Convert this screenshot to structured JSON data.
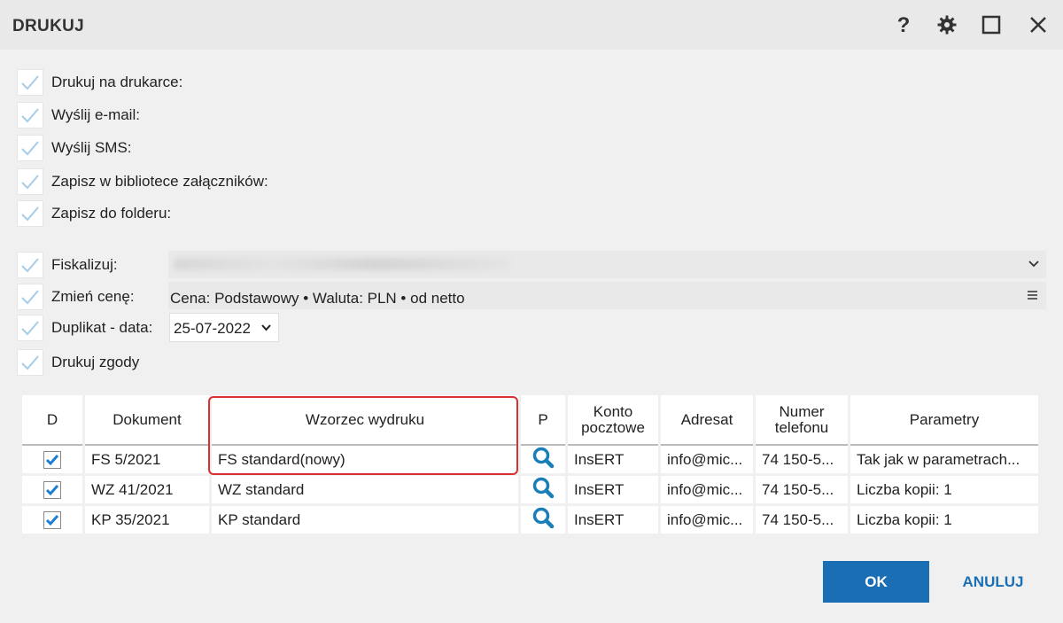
{
  "window": {
    "title": "DRUKUJ"
  },
  "options": [
    {
      "label": "Drukuj na drukarce:"
    },
    {
      "label": "Wyślij e-mail:"
    },
    {
      "label": "Wyślij SMS:"
    },
    {
      "label": "Zapisz w bibliotece załączników:"
    },
    {
      "label": "Zapisz do folderu:"
    },
    {
      "label": "Fiskalizuj:"
    },
    {
      "label": "Zmień cenę:"
    },
    {
      "label": "Duplikat - data:"
    },
    {
      "label": "Drukuj zgody"
    }
  ],
  "price": {
    "value": "Cena: Podstawowy • Waluta: PLN • od netto"
  },
  "duplicate": {
    "date": "25-07-2022"
  },
  "table": {
    "headers": {
      "d": "D",
      "doc": "Dokument",
      "template": "Wzorzec wydruku",
      "p": "P",
      "konto_1": "Konto",
      "konto_2": "pocztowe",
      "addr": "Adresat",
      "phone_1": "Numer",
      "phone_2": "telefonu",
      "params": "Parametry"
    },
    "rows": [
      {
        "doc": "FS 5/2021",
        "template": "FS standard(nowy)",
        "account": "InsERT",
        "addr": "info@mic...",
        "phone": "74 150-5...",
        "params": "Tak jak w parametrach..."
      },
      {
        "doc": "WZ 41/2021",
        "template": "WZ standard",
        "account": "InsERT",
        "addr": "info@mic...",
        "phone": "74 150-5...",
        "params": "Liczba kopii: 1"
      },
      {
        "doc": "KP 35/2021",
        "template": "KP standard",
        "account": "InsERT",
        "addr": "info@mic...",
        "phone": "74 150-5...",
        "params": "Liczba kopii: 1"
      }
    ]
  },
  "buttons": {
    "ok": "OK",
    "cancel": "ANULUJ"
  },
  "colors": {
    "accent": "#1a6fb4",
    "highlight": "#d93030",
    "search_icon": "#1a7fb8",
    "checkbox": "#1a7fd4"
  }
}
